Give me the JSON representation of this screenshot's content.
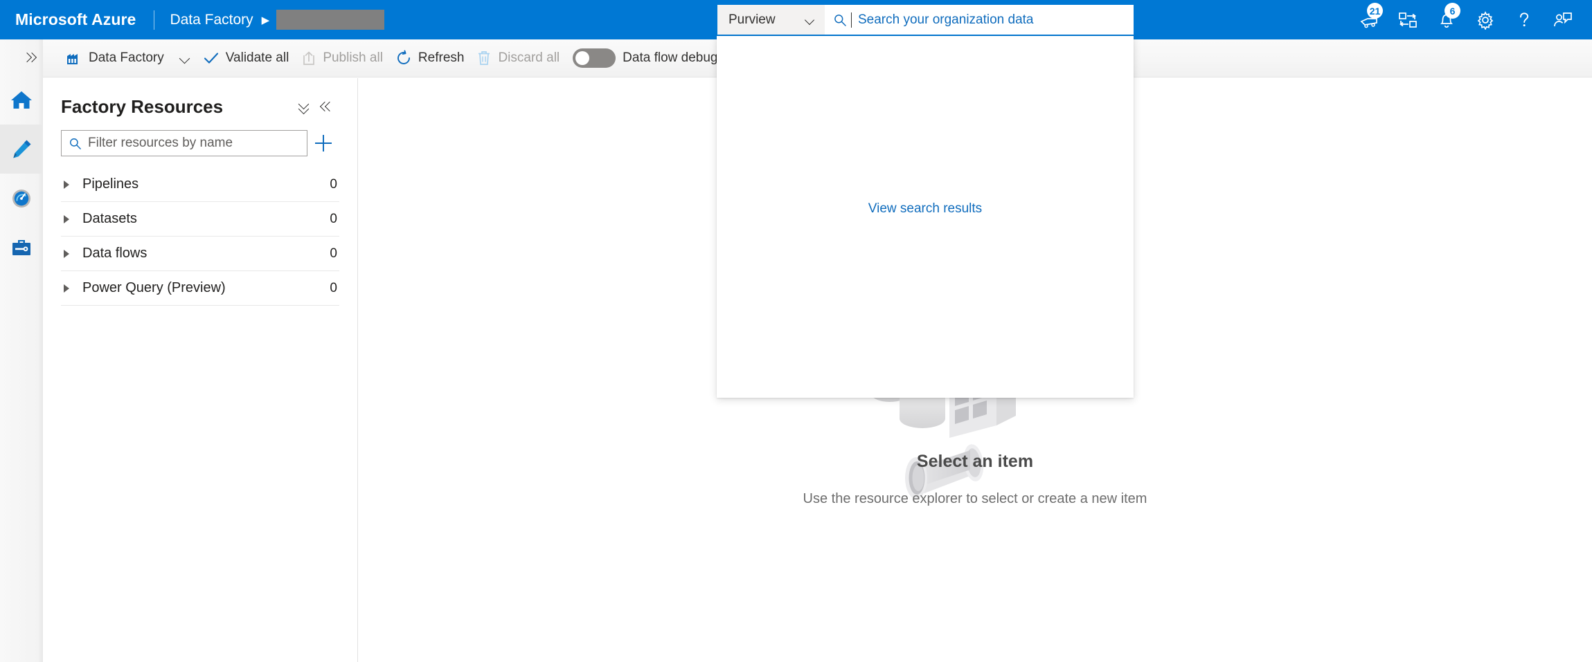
{
  "header": {
    "brand": "Microsoft Azure",
    "breadcrumb_service": "Data Factory",
    "breadcrumb_arrow": "▶",
    "breadcrumb_redacted": "",
    "icons": [
      {
        "name": "cloud-shell-icon",
        "badge": "21"
      },
      {
        "name": "directories-subscriptions-icon",
        "badge": ""
      },
      {
        "name": "notifications-bell-icon",
        "badge": "6"
      },
      {
        "name": "settings-gear-icon",
        "badge": ""
      },
      {
        "name": "help-question-icon",
        "badge": ""
      },
      {
        "name": "feedback-person-icon",
        "badge": ""
      }
    ]
  },
  "search": {
    "scope_label": "Purview",
    "placeholder": "Search your organization data",
    "value": "",
    "panel_link": "View search results"
  },
  "left_rail": {
    "expand_label": "Expand navigation",
    "items": [
      {
        "name": "home-icon",
        "label": "Home",
        "selected": false
      },
      {
        "name": "author-pencil-icon",
        "label": "Author",
        "selected": true
      },
      {
        "name": "monitor-gauge-icon",
        "label": "Monitor",
        "selected": false
      },
      {
        "name": "manage-toolbox-icon",
        "label": "Manage",
        "selected": false
      }
    ]
  },
  "toolbar": {
    "data_factory_label": "Data Factory",
    "validate_all_label": "Validate all",
    "publish_all_label": "Publish all",
    "refresh_label": "Refresh",
    "discard_all_label": "Discard all",
    "data_flow_debug_label": "Data flow debug",
    "data_flow_debug_on": false
  },
  "factory_resources": {
    "title": "Factory Resources",
    "collapse_all_label": "Collapse all",
    "hide_panel_label": "Hide panel",
    "filter_placeholder": "Filter resources by name",
    "filter_value": "",
    "add_label": "Add new resource",
    "rows": [
      {
        "label": "Pipelines",
        "count": "0"
      },
      {
        "label": "Datasets",
        "count": "0"
      },
      {
        "label": "Data flows",
        "count": "0"
      },
      {
        "label": "Power Query (Preview)",
        "count": "0"
      }
    ]
  },
  "empty_state": {
    "title": "Select an item",
    "subtitle": "Use the resource explorer to select or create a new item"
  },
  "colors": {
    "azure_blue": "#0078d4",
    "link_blue": "#0f6cbd",
    "toolbar_bg": "#f6f6f6",
    "redacted_gray": "#808080"
  }
}
